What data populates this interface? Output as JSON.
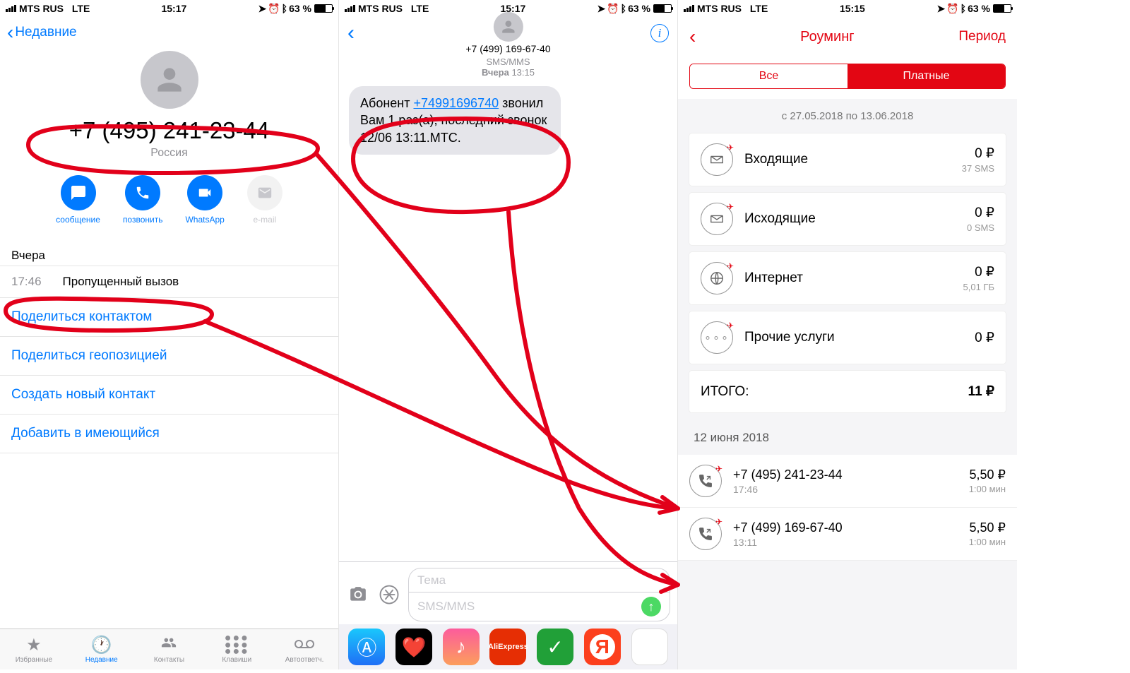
{
  "status": {
    "carrier": "MTS RUS",
    "net": "LTE",
    "time1": "15:17",
    "time2": "15:17",
    "time3": "15:15",
    "battery": "63 %"
  },
  "pane1": {
    "back": "Недавние",
    "phone": "+7 (495) 241-23-44",
    "country": "Россия",
    "actions": {
      "message": "сообщение",
      "call": "позвонить",
      "whatsapp": "WhatsApp",
      "email": "e-mail"
    },
    "day": "Вчера",
    "missed_time": "17:46",
    "missed_label": "Пропущенный вызов",
    "links": {
      "share_contact": "Поделиться контактом",
      "share_location": "Поделиться геопозицией",
      "create": "Создать новый контакт",
      "add": "Добавить в имеющийся"
    },
    "tabs": {
      "fav": "Избранные",
      "recent": "Недавние",
      "contacts": "Контакты",
      "keypad": "Клавиши",
      "vm": "Автоответч."
    }
  },
  "pane2": {
    "number": "+7 (499) 169-67-40",
    "stamp_service": "SMS/MMS",
    "stamp_day": "Вчера",
    "stamp_time": "13:15",
    "msg_pre": "Абонент ",
    "msg_link": "+74991696740",
    "msg_post": " звонил Вам 1 раз(а), последний звонок 12/06 13:11.МТС.",
    "subject_ph": "Тема",
    "body_ph": "SMS/MMS"
  },
  "pane3": {
    "title": "Роуминг",
    "period_btn": "Период",
    "seg_all": "Все",
    "seg_paid": "Платные",
    "range": "с 27.05.2018 по 13.06.2018",
    "rows": [
      {
        "name": "Входящие",
        "amt": "0 ₽",
        "sub": "37 SMS"
      },
      {
        "name": "Исходящие",
        "amt": "0 ₽",
        "sub": "0 SMS"
      },
      {
        "name": "Интернет",
        "amt": "0 ₽",
        "sub": "5,01 ГБ"
      },
      {
        "name": "Прочие услуги",
        "amt": "0 ₽",
        "sub": ""
      }
    ],
    "total_label": "ИТОГО:",
    "total_amt": "11 ₽",
    "log_date": "12 июня 2018",
    "log": [
      {
        "phone": "+7 (495) 241-23-44",
        "time": "17:46",
        "amt": "5,50 ₽",
        "dur": "1:00 мин"
      },
      {
        "phone": "+7 (499) 169-67-40",
        "time": "13:11",
        "amt": "5,50 ₽",
        "dur": "1:00 мин"
      }
    ]
  }
}
